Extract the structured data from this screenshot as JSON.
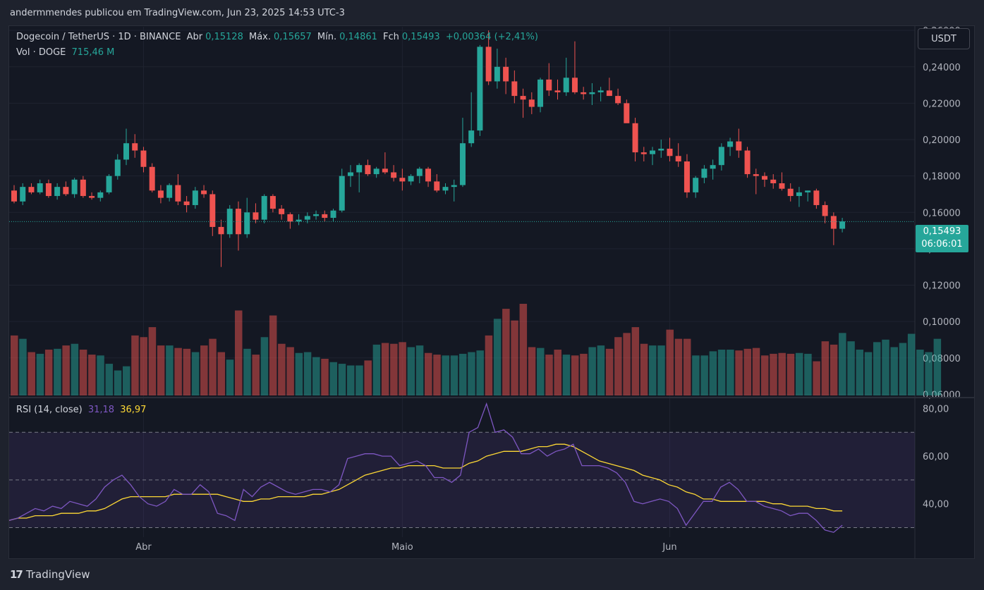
{
  "top_line": "andermmendes publicou em TradingView.com, Jun 23, 2025 14:53 UTC-3",
  "legend": {
    "symbol": "Dogecoin / TetherUS · 1D · BINANCE",
    "open_label": "Abr",
    "open": "0,15128",
    "high_label": "Máx.",
    "high": "0,15657",
    "low_label": "Mín.",
    "low": "0,14861",
    "close_label": "Fch",
    "close": "0,15493",
    "change": "+0,00364 (+2,41%)",
    "vol_label": "Vol · DOGE",
    "vol_value": "715,46 M",
    "rsi_label": "RSI (14, close)",
    "rsi_value": "31,18",
    "rsi_ma_value": "36,97"
  },
  "currency_button": "USDT",
  "last_price": {
    "price": "0,15493",
    "countdown": "06:06:01"
  },
  "footer": {
    "logo": "17",
    "brand": "TradingView"
  },
  "colors": {
    "up": "#26a69a",
    "down": "#ef5350",
    "rsi": "#7e57c2",
    "rsi_ma": "#fdd835",
    "background": "#141823"
  },
  "chart_data": {
    "type": "candlestick",
    "price_axis_ticks": [
      "0,26000",
      "0,24000",
      "0,22000",
      "0,20000",
      "0,18000",
      "0,16000",
      "0,14000",
      "0,12000",
      "0,10000",
      "0,08000",
      "0,06000"
    ],
    "price_range": [
      0.059,
      0.262
    ],
    "x_tick_labels": [
      {
        "label": "Abr",
        "index": 15
      },
      {
        "label": "Maio",
        "index": 45
      },
      {
        "label": "Jun",
        "index": 76
      }
    ],
    "candles": [
      [
        0.172,
        0.175,
        0.165,
        0.166
      ],
      [
        0.166,
        0.176,
        0.164,
        0.174
      ],
      [
        0.174,
        0.176,
        0.17,
        0.171
      ],
      [
        0.171,
        0.178,
        0.17,
        0.176
      ],
      [
        0.176,
        0.178,
        0.168,
        0.169
      ],
      [
        0.169,
        0.176,
        0.167,
        0.174
      ],
      [
        0.174,
        0.177,
        0.169,
        0.17
      ],
      [
        0.17,
        0.179,
        0.168,
        0.178
      ],
      [
        0.178,
        0.18,
        0.168,
        0.169
      ],
      [
        0.169,
        0.171,
        0.167,
        0.168
      ],
      [
        0.168,
        0.172,
        0.166,
        0.171
      ],
      [
        0.171,
        0.181,
        0.17,
        0.18
      ],
      [
        0.18,
        0.192,
        0.178,
        0.189
      ],
      [
        0.189,
        0.206,
        0.186,
        0.198
      ],
      [
        0.198,
        0.203,
        0.19,
        0.194
      ],
      [
        0.194,
        0.196,
        0.182,
        0.185
      ],
      [
        0.185,
        0.187,
        0.171,
        0.172
      ],
      [
        0.172,
        0.175,
        0.165,
        0.168
      ],
      [
        0.168,
        0.176,
        0.166,
        0.175
      ],
      [
        0.175,
        0.181,
        0.164,
        0.166
      ],
      [
        0.166,
        0.169,
        0.16,
        0.164
      ],
      [
        0.164,
        0.174,
        0.162,
        0.172
      ],
      [
        0.172,
        0.175,
        0.168,
        0.17
      ],
      [
        0.17,
        0.172,
        0.147,
        0.152
      ],
      [
        0.152,
        0.156,
        0.13,
        0.148
      ],
      [
        0.148,
        0.164,
        0.146,
        0.162
      ],
      [
        0.162,
        0.166,
        0.139,
        0.148
      ],
      [
        0.148,
        0.168,
        0.146,
        0.16
      ],
      [
        0.16,
        0.165,
        0.154,
        0.156
      ],
      [
        0.156,
        0.17,
        0.154,
        0.169
      ],
      [
        0.169,
        0.17,
        0.16,
        0.162
      ],
      [
        0.162,
        0.164,
        0.156,
        0.159
      ],
      [
        0.159,
        0.16,
        0.151,
        0.155
      ],
      [
        0.155,
        0.159,
        0.153,
        0.156
      ],
      [
        0.156,
        0.16,
        0.154,
        0.158
      ],
      [
        0.158,
        0.161,
        0.156,
        0.159
      ],
      [
        0.159,
        0.161,
        0.155,
        0.157
      ],
      [
        0.157,
        0.162,
        0.155,
        0.161
      ],
      [
        0.161,
        0.184,
        0.16,
        0.18
      ],
      [
        0.18,
        0.186,
        0.174,
        0.182
      ],
      [
        0.182,
        0.187,
        0.171,
        0.186
      ],
      [
        0.186,
        0.189,
        0.18,
        0.181
      ],
      [
        0.181,
        0.185,
        0.179,
        0.184
      ],
      [
        0.184,
        0.193,
        0.181,
        0.182
      ],
      [
        0.182,
        0.186,
        0.177,
        0.179
      ],
      [
        0.179,
        0.184,
        0.172,
        0.177
      ],
      [
        0.177,
        0.181,
        0.175,
        0.18
      ],
      [
        0.18,
        0.185,
        0.176,
        0.184
      ],
      [
        0.184,
        0.185,
        0.174,
        0.177
      ],
      [
        0.177,
        0.181,
        0.171,
        0.172
      ],
      [
        0.172,
        0.176,
        0.17,
        0.174
      ],
      [
        0.174,
        0.178,
        0.166,
        0.175
      ],
      [
        0.175,
        0.212,
        0.174,
        0.198
      ],
      [
        0.198,
        0.226,
        0.196,
        0.205
      ],
      [
        0.205,
        0.252,
        0.202,
        0.251
      ],
      [
        0.251,
        0.26,
        0.23,
        0.232
      ],
      [
        0.232,
        0.25,
        0.228,
        0.24
      ],
      [
        0.24,
        0.245,
        0.225,
        0.232
      ],
      [
        0.232,
        0.238,
        0.22,
        0.224
      ],
      [
        0.224,
        0.228,
        0.212,
        0.222
      ],
      [
        0.222,
        0.226,
        0.214,
        0.218
      ],
      [
        0.218,
        0.234,
        0.215,
        0.233
      ],
      [
        0.233,
        0.242,
        0.224,
        0.227
      ],
      [
        0.227,
        0.233,
        0.222,
        0.226
      ],
      [
        0.226,
        0.245,
        0.224,
        0.234
      ],
      [
        0.234,
        0.254,
        0.225,
        0.226
      ],
      [
        0.226,
        0.229,
        0.222,
        0.225
      ],
      [
        0.225,
        0.231,
        0.219,
        0.226
      ],
      [
        0.226,
        0.229,
        0.221,
        0.227
      ],
      [
        0.227,
        0.234,
        0.224,
        0.224
      ],
      [
        0.224,
        0.228,
        0.219,
        0.22
      ],
      [
        0.22,
        0.222,
        0.21,
        0.209
      ],
      [
        0.209,
        0.212,
        0.188,
        0.193
      ],
      [
        0.193,
        0.196,
        0.188,
        0.192
      ],
      [
        0.192,
        0.196,
        0.186,
        0.194
      ],
      [
        0.194,
        0.2,
        0.19,
        0.195
      ],
      [
        0.195,
        0.201,
        0.188,
        0.191
      ],
      [
        0.191,
        0.198,
        0.185,
        0.188
      ],
      [
        0.188,
        0.192,
        0.168,
        0.171
      ],
      [
        0.171,
        0.18,
        0.168,
        0.179
      ],
      [
        0.179,
        0.186,
        0.176,
        0.184
      ],
      [
        0.184,
        0.189,
        0.178,
        0.186
      ],
      [
        0.186,
        0.198,
        0.183,
        0.196
      ],
      [
        0.196,
        0.201,
        0.191,
        0.199
      ],
      [
        0.199,
        0.206,
        0.19,
        0.194
      ],
      [
        0.194,
        0.196,
        0.179,
        0.181
      ],
      [
        0.181,
        0.184,
        0.17,
        0.18
      ],
      [
        0.18,
        0.182,
        0.174,
        0.178
      ],
      [
        0.178,
        0.181,
        0.173,
        0.176
      ],
      [
        0.176,
        0.182,
        0.172,
        0.173
      ],
      [
        0.173,
        0.176,
        0.166,
        0.169
      ],
      [
        0.169,
        0.174,
        0.163,
        0.171
      ],
      [
        0.171,
        0.172,
        0.166,
        0.172
      ],
      [
        0.172,
        0.173,
        0.162,
        0.164
      ],
      [
        0.164,
        0.166,
        0.154,
        0.158
      ],
      [
        0.158,
        0.16,
        0.142,
        0.151
      ],
      [
        0.151,
        0.157,
        0.149,
        0.155
      ]
    ],
    "volume": [
      72,
      68,
      52,
      50,
      55,
      56,
      60,
      62,
      55,
      49,
      48,
      38,
      30,
      35,
      72,
      70,
      82,
      60,
      60,
      57,
      56,
      52,
      60,
      68,
      52,
      43,
      102,
      56,
      49,
      70,
      96,
      62,
      58,
      51,
      52,
      46,
      44,
      40,
      38,
      36,
      36,
      42,
      61,
      63,
      62,
      64,
      58,
      60,
      51,
      49,
      48,
      48,
      50,
      52,
      54,
      72,
      92,
      104,
      90,
      110,
      58,
      57,
      49,
      55,
      49,
      48,
      50,
      58,
      60,
      56,
      70,
      75,
      82,
      62,
      60,
      60,
      79,
      68,
      68,
      48,
      48,
      53,
      55,
      55,
      54,
      56,
      57,
      48,
      50,
      51,
      50,
      51,
      50,
      41,
      65,
      61,
      75,
      65,
      55,
      52,
      64,
      67,
      58,
      63,
      74,
      55,
      52,
      68
    ],
    "volume_max_label": "DOGE",
    "rsi": [
      33,
      34,
      36,
      38,
      37,
      39,
      38,
      41,
      40,
      39,
      42,
      47,
      50,
      52,
      48,
      43,
      40,
      39,
      41,
      46,
      44,
      44,
      48,
      45,
      36,
      35,
      33,
      46,
      43,
      47,
      49,
      47,
      45,
      44,
      45,
      46,
      46,
      45,
      48,
      59,
      60,
      61,
      61,
      60,
      60,
      56,
      57,
      58,
      56,
      51,
      51,
      49,
      52,
      70,
      72,
      82,
      70,
      71,
      68,
      61,
      61,
      63,
      60,
      62,
      63,
      65,
      56,
      56,
      56,
      55,
      53,
      49,
      41,
      40,
      41,
      42,
      41,
      38,
      31,
      36,
      41,
      41,
      47,
      49,
      46,
      41,
      41,
      39,
      38,
      37,
      35,
      36,
      36,
      33,
      29,
      28,
      31
    ],
    "rsi_ma": [
      33,
      34,
      34,
      35,
      35,
      35,
      36,
      36,
      36,
      37,
      37,
      38,
      40,
      42,
      43,
      43,
      43,
      43,
      43,
      44,
      44,
      44,
      44,
      44,
      44,
      43,
      42,
      41,
      41,
      42,
      42,
      43,
      43,
      43,
      43,
      44,
      44,
      45,
      46,
      48,
      50,
      52,
      53,
      54,
      55,
      55,
      56,
      56,
      56,
      56,
      55,
      55,
      55,
      57,
      58,
      60,
      61,
      62,
      62,
      62,
      63,
      64,
      64,
      65,
      65,
      64,
      62,
      60,
      58,
      57,
      56,
      55,
      54,
      52,
      51,
      50,
      48,
      47,
      45,
      44,
      42,
      42,
      41,
      41,
      41,
      41,
      41,
      41,
      40,
      40,
      39,
      39,
      39,
      38,
      38,
      37,
      37
    ],
    "rsi_axis_ticks": [
      "80,00",
      "60,00",
      "40,00"
    ],
    "rsi_range": [
      26,
      84
    ],
    "rsi_band": [
      30,
      70
    ],
    "last_price_value": 0.15493
  }
}
